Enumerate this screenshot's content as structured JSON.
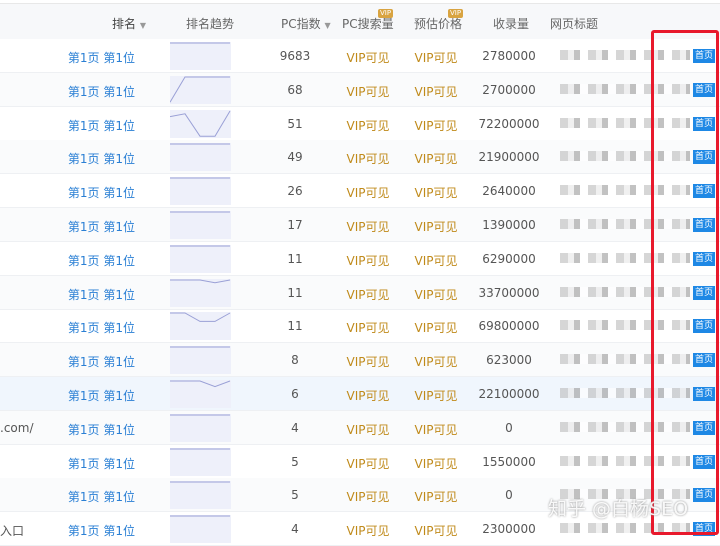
{
  "header": {
    "rank": "排名",
    "trend": "排名趋势",
    "pc_index": "PC指数",
    "pc_search": "PC搜索量",
    "price": "预估价格",
    "indexed": "收录量",
    "title": "网页标题",
    "vip_tag": "VIP"
  },
  "rows": [
    {
      "kw": "",
      "rank": "第1页 第1位",
      "pc": "9683",
      "sv": "VIP可见",
      "pr": "VIP可见",
      "inc": "2780000",
      "badge": "首页",
      "trend": [
        1,
        1,
        1,
        1,
        1
      ]
    },
    {
      "kw": "",
      "rank": "第1页 第1位",
      "pc": "68",
      "sv": "VIP可见",
      "pr": "VIP可见",
      "inc": "2700000",
      "badge": "首页",
      "trend": [
        10,
        1,
        1,
        1,
        1
      ]
    },
    {
      "kw": "",
      "rank": "第1页 第1位",
      "pc": "51",
      "sv": "VIP可见",
      "pr": "VIP可见",
      "inc": "72200000",
      "badge": "首页",
      "trend": [
        3,
        2,
        10,
        10,
        1
      ]
    },
    {
      "kw": "",
      "rank": "第1页 第1位",
      "pc": "49",
      "sv": "VIP可见",
      "pr": "VIP可见",
      "inc": "21900000",
      "badge": "首页",
      "trend": [
        1,
        1,
        1,
        1,
        1
      ]
    },
    {
      "kw": "",
      "rank": "第1页 第1位",
      "pc": "26",
      "sv": "VIP可见",
      "pr": "VIP可见",
      "inc": "2640000",
      "badge": "首页",
      "trend": [
        1,
        1,
        1,
        1,
        1
      ]
    },
    {
      "kw": "",
      "rank": "第1页 第1位",
      "pc": "17",
      "sv": "VIP可见",
      "pr": "VIP可见",
      "inc": "1390000",
      "badge": "首页",
      "trend": [
        1,
        1,
        1,
        1,
        1
      ]
    },
    {
      "kw": "",
      "rank": "第1页 第1位",
      "pc": "11",
      "sv": "VIP可见",
      "pr": "VIP可见",
      "inc": "6290000",
      "badge": "首页",
      "trend": [
        1,
        1,
        1,
        1,
        1
      ]
    },
    {
      "kw": "",
      "rank": "第1页 第1位",
      "pc": "11",
      "sv": "VIP可见",
      "pr": "VIP可见",
      "inc": "33700000",
      "badge": "首页",
      "trend": [
        1,
        1,
        1,
        2,
        1
      ]
    },
    {
      "kw": "",
      "rank": "第1页 第1位",
      "pc": "11",
      "sv": "VIP可见",
      "pr": "VIP可见",
      "inc": "69800000",
      "badge": "首页",
      "trend": [
        1,
        1,
        4,
        4,
        1
      ]
    },
    {
      "kw": "",
      "rank": "第1页 第1位",
      "pc": "8",
      "sv": "VIP可见",
      "pr": "VIP可见",
      "inc": "623000",
      "badge": "首页",
      "trend": [
        1,
        1,
        1,
        1,
        1
      ]
    },
    {
      "kw": "",
      "rank": "第1页 第1位",
      "pc": "6",
      "sv": "VIP可见",
      "pr": "VIP可见",
      "inc": "22100000",
      "badge": "首页",
      "trend": [
        1,
        1,
        1,
        3,
        1
      ]
    },
    {
      "kw": ".com/",
      "rank": "第1页 第1位",
      "pc": "4",
      "sv": "VIP可见",
      "pr": "VIP可见",
      "inc": "0",
      "badge": "首页",
      "trend": [
        1,
        1,
        1,
        1,
        1
      ]
    },
    {
      "kw": "",
      "rank": "第1页 第1位",
      "pc": "5",
      "sv": "VIP可见",
      "pr": "VIP可见",
      "inc": "1550000",
      "badge": "首页",
      "trend": [
        1,
        1,
        1,
        1,
        1
      ]
    },
    {
      "kw": "",
      "rank": "第1页 第1位",
      "pc": "5",
      "sv": "VIP可见",
      "pr": "VIP可见",
      "inc": "0",
      "badge": "首页",
      "trend": [
        1,
        1,
        1,
        1,
        1
      ]
    },
    {
      "kw": "入口",
      "rank": "第1页 第1位",
      "pc": "4",
      "sv": "VIP可见",
      "pr": "VIP可见",
      "inc": "2300000",
      "badge": "首页",
      "trend": [
        1,
        1,
        1,
        1,
        1
      ]
    }
  ],
  "watermark": "知乎 @白杨SEO",
  "colors": {
    "link": "#2a7fd4",
    "vip": "#c08a1a",
    "badge": "#1e88e5",
    "highlight": "#e8192c"
  }
}
